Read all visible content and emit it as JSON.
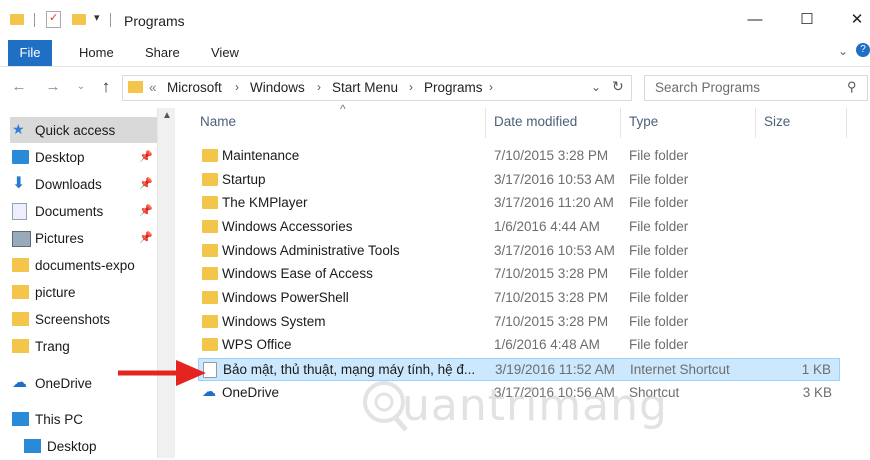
{
  "window": {
    "title": "Programs",
    "controls": {
      "minimize": "—",
      "maximize": "☐",
      "close": "✕"
    }
  },
  "ribbon": {
    "tabs": [
      "File",
      "Home",
      "Share",
      "View"
    ],
    "expand_icon": "chevron-down-icon",
    "help_icon": "help-icon"
  },
  "address": {
    "overflow": "«",
    "crumbs": [
      "Microsoft",
      "Windows",
      "Start Menu",
      "Programs"
    ],
    "separator": "›"
  },
  "search": {
    "placeholder": "Search Programs"
  },
  "nav": {
    "items": [
      {
        "label": "Quick access",
        "icon": "star-icon",
        "pinned": false
      },
      {
        "label": "Desktop",
        "icon": "desktop-icon",
        "pinned": true
      },
      {
        "label": "Downloads",
        "icon": "download-icon",
        "pinned": true
      },
      {
        "label": "Documents",
        "icon": "documents-icon",
        "pinned": true
      },
      {
        "label": "Pictures",
        "icon": "pictures-icon",
        "pinned": true
      },
      {
        "label": "documents-expo",
        "icon": "folder-icon",
        "pinned": false
      },
      {
        "label": "picture",
        "icon": "folder-icon",
        "pinned": false
      },
      {
        "label": "Screenshots",
        "icon": "folder-icon",
        "pinned": false
      },
      {
        "label": "Trang",
        "icon": "folder-icon",
        "pinned": false
      },
      {
        "label": "OneDrive",
        "icon": "onedrive-icon",
        "pinned": false
      },
      {
        "label": "This PC",
        "icon": "pc-icon",
        "pinned": false
      },
      {
        "label": "Desktop",
        "icon": "desktop-icon",
        "pinned": false
      }
    ]
  },
  "columns": {
    "name": "Name",
    "date": "Date modified",
    "type": "Type",
    "size": "Size"
  },
  "files": [
    {
      "name": "Maintenance",
      "date": "7/10/2015 3:28 PM",
      "type": "File folder",
      "size": ""
    },
    {
      "name": "Startup",
      "date": "3/17/2016 10:53 AM",
      "type": "File folder",
      "size": ""
    },
    {
      "name": "The KMPlayer",
      "date": "3/17/2016 11:20 AM",
      "type": "File folder",
      "size": ""
    },
    {
      "name": "Windows Accessories",
      "date": "1/6/2016 4:44 AM",
      "type": "File folder",
      "size": ""
    },
    {
      "name": "Windows Administrative Tools",
      "date": "3/17/2016 10:53 AM",
      "type": "File folder",
      "size": ""
    },
    {
      "name": "Windows Ease of Access",
      "date": "7/10/2015 3:28 PM",
      "type": "File folder",
      "size": ""
    },
    {
      "name": "Windows PowerShell",
      "date": "7/10/2015 3:28 PM",
      "type": "File folder",
      "size": ""
    },
    {
      "name": "Windows System",
      "date": "7/10/2015 3:28 PM",
      "type": "File folder",
      "size": ""
    },
    {
      "name": "WPS Office",
      "date": "1/6/2016 4:48 AM",
      "type": "File folder",
      "size": ""
    },
    {
      "name": "Bảo mật, thủ thuật, mạng máy tính, hệ đ...",
      "date": "3/19/2016 11:52 AM",
      "type": "Internet Shortcut",
      "size": "1 KB"
    },
    {
      "name": "OneDrive",
      "date": "3/17/2016 10:56 AM",
      "type": "Shortcut",
      "size": "3 KB"
    }
  ],
  "selected_index": 9,
  "watermark": "uantrimang",
  "colors": {
    "file_tab": "#1f6fc5",
    "selection": "#cce8ff",
    "folder": "#f3c54a",
    "arrow": "#e5231f"
  }
}
